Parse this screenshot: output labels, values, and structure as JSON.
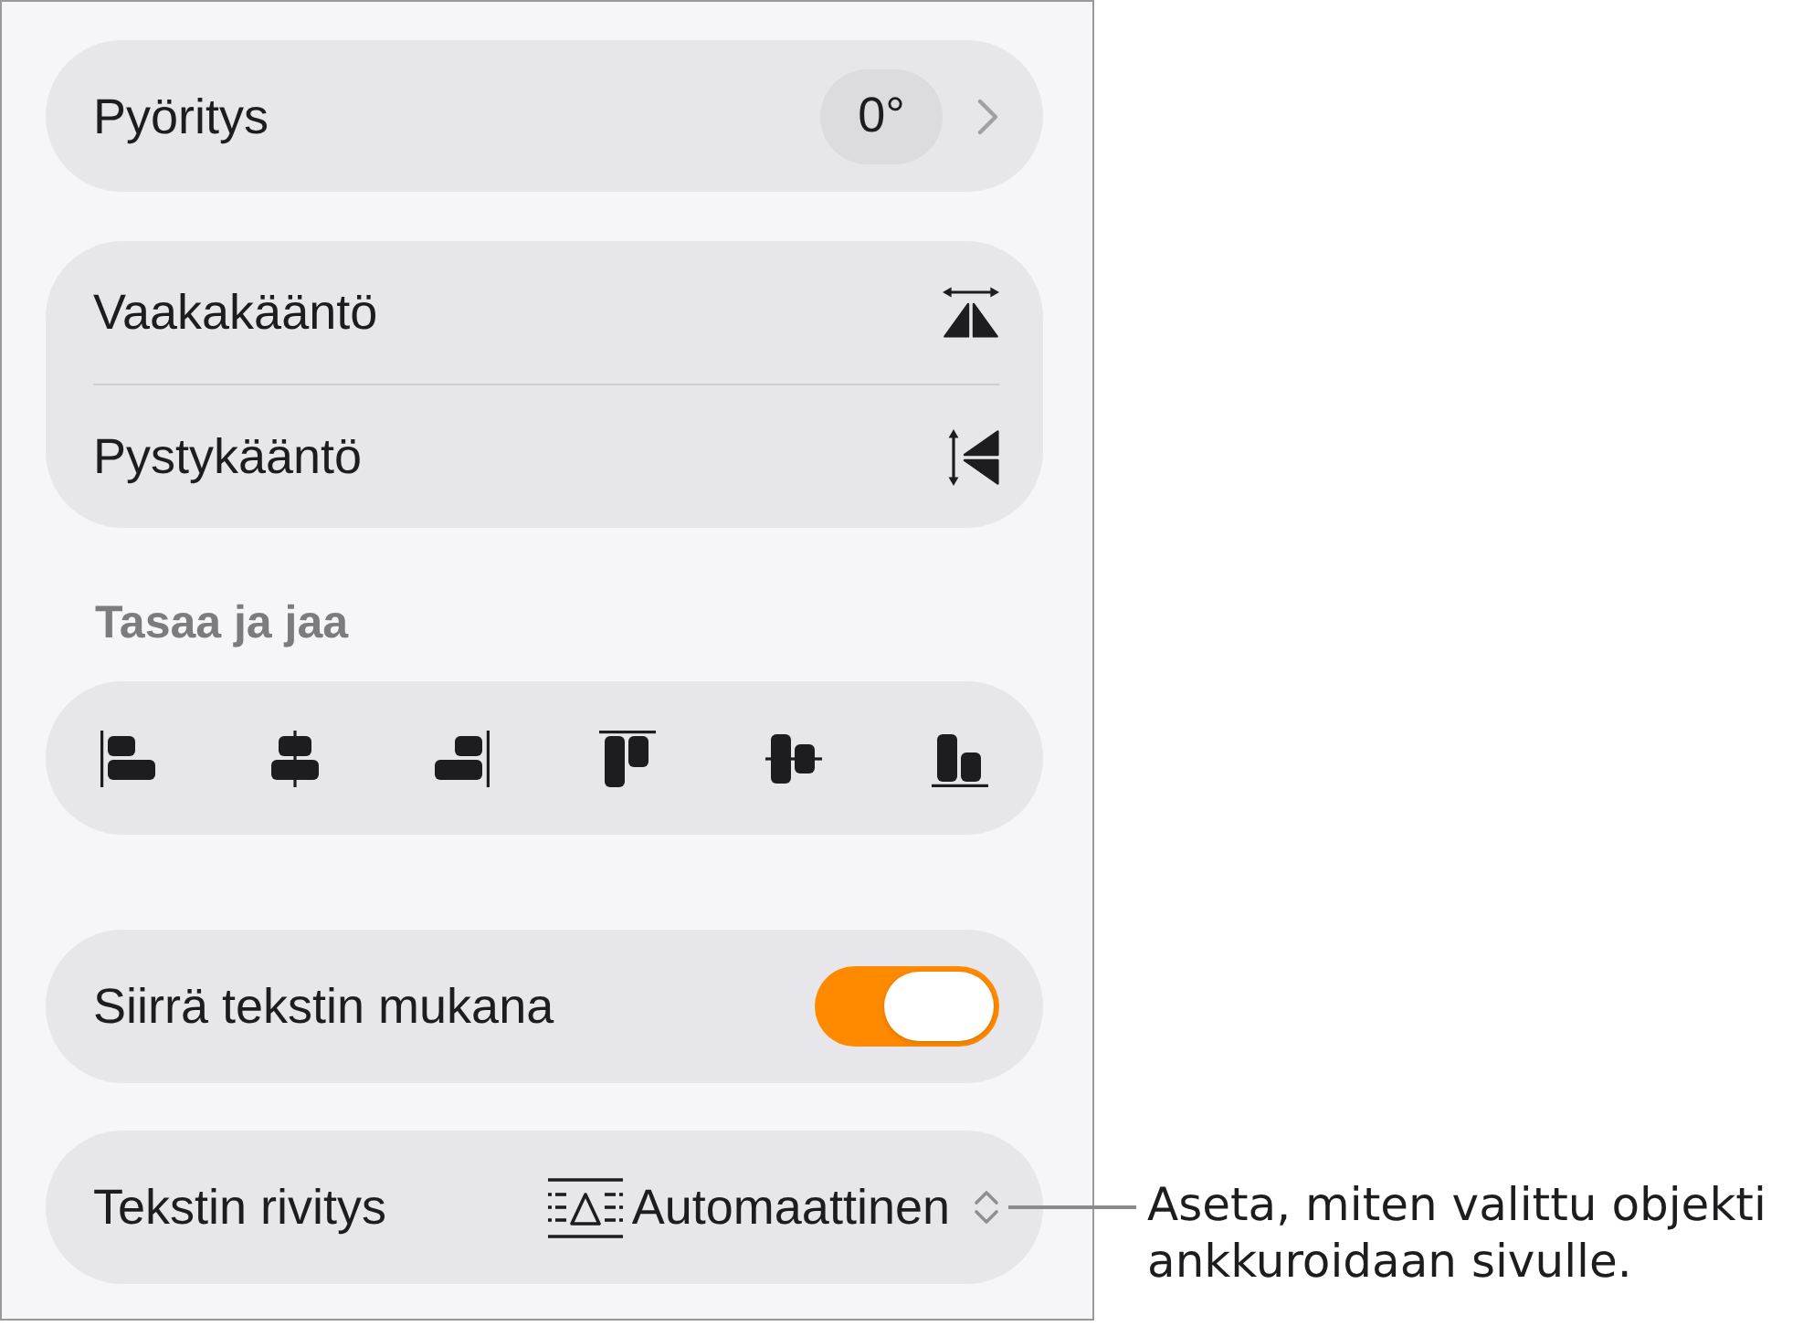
{
  "rotation": {
    "label": "Pyöritys",
    "value": "0°"
  },
  "flip": [
    {
      "kind": "horizontal",
      "label": "Vaakakääntö"
    },
    {
      "kind": "vertical",
      "label": "Pystykääntö"
    }
  ],
  "align": {
    "heading": "Tasaa ja jaa",
    "buttons": [
      {
        "kind": "left"
      },
      {
        "kind": "center"
      },
      {
        "kind": "right"
      },
      {
        "kind": "top"
      },
      {
        "kind": "middle"
      },
      {
        "kind": "bottom"
      }
    ]
  },
  "move_with_text": {
    "label": "Siirrä tekstin mukana",
    "on": true
  },
  "text_wrap": {
    "label": "Tekstin rivitys",
    "value": "Automaattinen"
  },
  "callout": {
    "text": "Aseta, miten valittu objekti ankkuroidaan sivulle."
  }
}
